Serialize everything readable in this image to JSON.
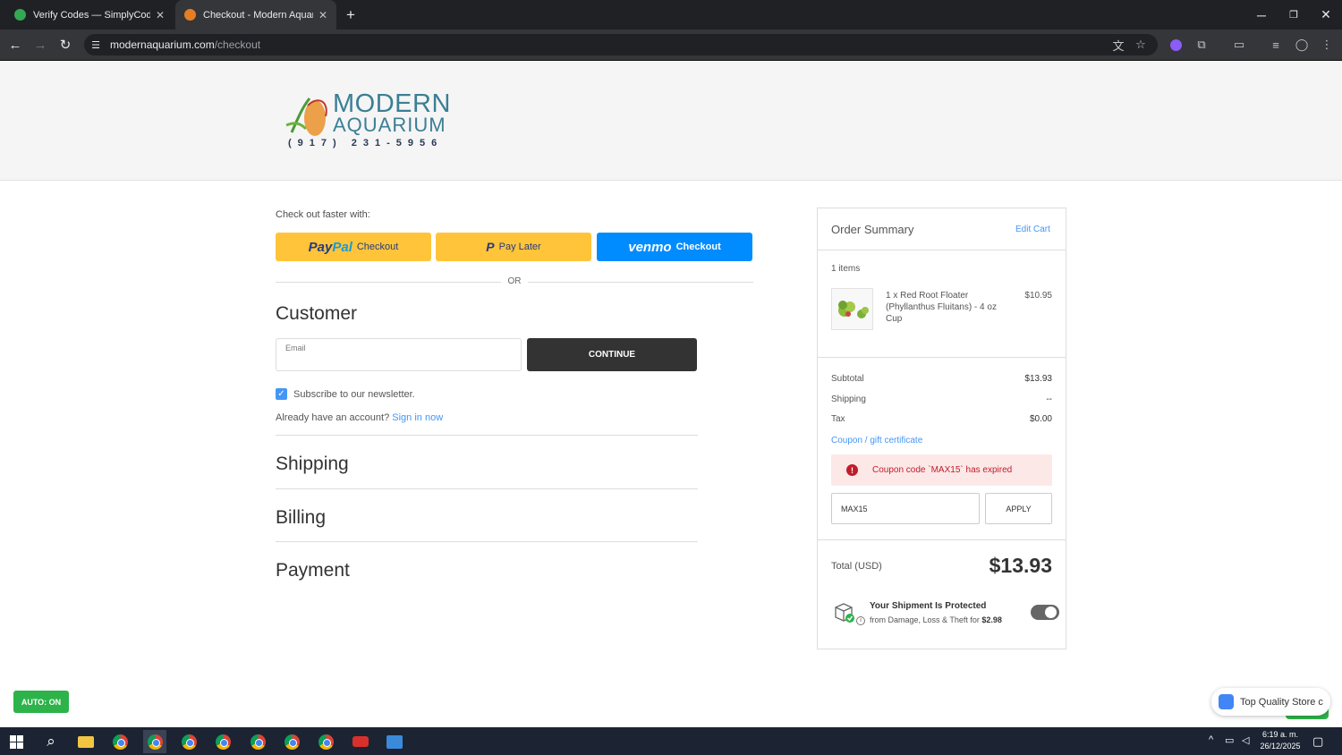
{
  "browser": {
    "tabs": [
      {
        "label": "Verify Codes — SimplyCodes",
        "icon": "simplycodes-icon",
        "color": "#34a853"
      },
      {
        "label": "Checkout - Modern Aquarium",
        "icon": "modern-aquarium-favicon",
        "color": "#e67e22"
      }
    ],
    "url_host": "modernaquarium.com",
    "url_path": "/checkout"
  },
  "brand": {
    "line1": "MODERN",
    "line2": "AQUARIUM",
    "phone": "(917) 231-5956"
  },
  "checkout": {
    "fast_label": "Check out faster with:",
    "paypal_word_a": "Pay",
    "paypal_word_b": "Pal",
    "paypal_label": "Checkout",
    "paylater_label": "Pay Later",
    "venmo_word": "venmo",
    "venmo_label": "Checkout",
    "or": "OR",
    "customer_title": "Customer",
    "email_label": "Email",
    "continue_label": "CONTINUE",
    "newsletter_label": "Subscribe to our newsletter.",
    "newsletter_checked": true,
    "account_text": "Already have an account?",
    "signin_label": "Sign in now",
    "shipping_title": "Shipping",
    "billing_title": "Billing",
    "payment_title": "Payment"
  },
  "summary": {
    "title": "Order Summary",
    "edit_cart": "Edit Cart",
    "items_count": "1 items",
    "item_name": "1 x Red Root Floater (Phyllanthus Fluitans) - 4 oz Cup",
    "item_price": "$10.95",
    "subtotal_label": "Subtotal",
    "subtotal_value": "$13.93",
    "shipping_label": "Shipping",
    "shipping_value": "--",
    "tax_label": "Tax",
    "tax_value": "$0.00",
    "coupon_link": "Coupon / gift certificate",
    "coupon_error": "Coupon code `MAX15` has expired",
    "coupon_value": "MAX15",
    "apply_label": "APPLY",
    "total_label": "Total (USD)",
    "total_value": "$13.93",
    "protect_title": "Your Shipment Is Protected",
    "protect_sub": "from Damage, Loss & Theft for",
    "protect_price": "$2.98",
    "protect_on": true
  },
  "widgets": {
    "auto_badge": "AUTO: ON",
    "store_popup": "Top Quality Store c"
  },
  "taskbar": {
    "time": "6:19 a. m.",
    "date": "26/12/2025"
  },
  "colors": {
    "accent_blue": "#4496f6",
    "paypal_yellow": "#ffc439",
    "venmo_blue": "#008cff",
    "error_red": "#c01c2a",
    "badge_green": "#2db34a"
  }
}
